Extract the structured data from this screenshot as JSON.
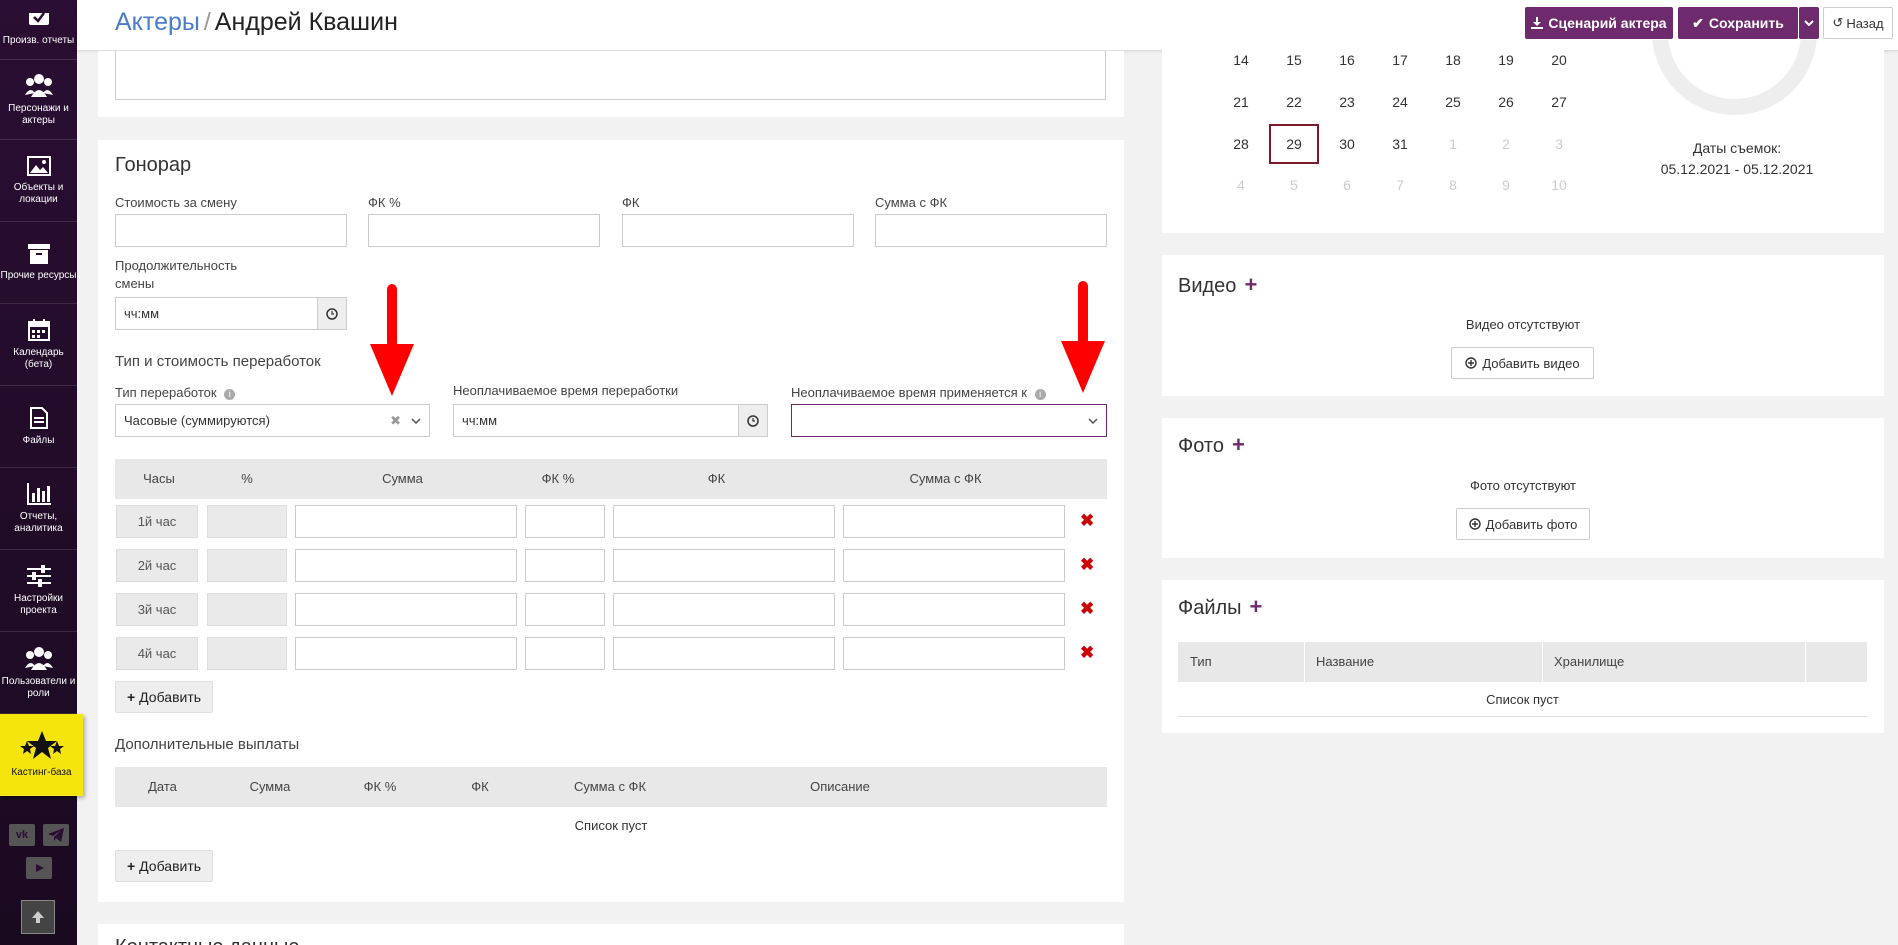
{
  "sidebar": {
    "items": [
      {
        "label": "Произв. отчеты",
        "icon": "check-icon"
      },
      {
        "label": "Персонажи и актеры",
        "icon": "users-icon"
      },
      {
        "label": "Объекты и локации",
        "icon": "image-icon"
      },
      {
        "label": "Прочие ресурсы",
        "icon": "box-icon"
      },
      {
        "label": "Календарь (бета)",
        "icon": "calendar-icon"
      },
      {
        "label": "Файлы",
        "icon": "file-icon"
      },
      {
        "label": "Отчеты, аналитика",
        "icon": "bar-chart-icon"
      },
      {
        "label": "Настройки проекта",
        "icon": "sliders-icon"
      },
      {
        "label": "Пользователи и роли",
        "icon": "users-icon"
      },
      {
        "label": "Кастинг-база",
        "icon": "stars-icon"
      }
    ],
    "social": [
      "vk",
      "telegram",
      "youtube"
    ]
  },
  "header": {
    "breadcrumb_link": "Актеры",
    "breadcrumb_sep": "/",
    "title": "Андрей Квашин",
    "script_button": "Сценарий актера",
    "save_button": "Сохранить",
    "back_button": "Назад"
  },
  "fee": {
    "title": "Гонорар",
    "labels": {
      "shift_cost": "Стоимость за смену",
      "fk_pct": "ФК %",
      "fk": "ФК",
      "sum_fk": "Сумма с ФК",
      "shift_duration": "Продолжительность смены"
    },
    "duration_placeholder": "чч:мм",
    "overtime_title": "Тип и стоимость переработок",
    "overtime_type_label": "Тип переработок",
    "overtime_type_value": "Часовые (суммируются)",
    "unpaid_time_label": "Неоплачиваемое время переработки",
    "unpaid_time_placeholder": "чч:мм",
    "unpaid_applies_label": "Неоплачиваемое время применяется к",
    "unpaid_applies_value": "",
    "table": {
      "headers": [
        "Часы",
        "%",
        "Сумма",
        "ФК %",
        "ФК",
        "Сумма с ФК"
      ],
      "rows": [
        "1й час",
        "2й час",
        "3й час",
        "4й час"
      ]
    },
    "add_button": "Добавить",
    "extra_title": "Дополнительные выплаты",
    "extra_headers": [
      "Дата",
      "Сумма",
      "ФК %",
      "ФК",
      "Сумма с ФК",
      "Описание"
    ],
    "extra_empty": "Список пуст",
    "extra_add_button": "Добавить",
    "next_section_partial": "Контактные данные"
  },
  "calendar": {
    "weeks": [
      [
        {
          "d": "14"
        },
        {
          "d": "15"
        },
        {
          "d": "16"
        },
        {
          "d": "17"
        },
        {
          "d": "18"
        },
        {
          "d": "19"
        },
        {
          "d": "20"
        }
      ],
      [
        {
          "d": "21"
        },
        {
          "d": "22"
        },
        {
          "d": "23"
        },
        {
          "d": "24"
        },
        {
          "d": "25"
        },
        {
          "d": "26"
        },
        {
          "d": "27"
        }
      ],
      [
        {
          "d": "28"
        },
        {
          "d": "29",
          "today": true
        },
        {
          "d": "30"
        },
        {
          "d": "31"
        },
        {
          "d": "1",
          "muted": true
        },
        {
          "d": "2",
          "muted": true
        },
        {
          "d": "3",
          "muted": true
        }
      ],
      [
        {
          "d": "4",
          "muted": true
        },
        {
          "d": "5",
          "muted": true
        },
        {
          "d": "6",
          "muted": true
        },
        {
          "d": "7",
          "muted": true
        },
        {
          "d": "8",
          "muted": true
        },
        {
          "d": "9",
          "muted": true
        },
        {
          "d": "10",
          "muted": true
        }
      ]
    ],
    "shoot_dates_label": "Даты съемок:",
    "shoot_dates_value": "05.12.2021 - 05.12.2021"
  },
  "video": {
    "title": "Видео",
    "empty": "Видео отсутствуют",
    "add_button": "Добавить видео"
  },
  "photo": {
    "title": "Фото",
    "empty": "Фото отсутствуют",
    "add_button": "Добавить фото"
  },
  "files": {
    "title": "Файлы",
    "headers": [
      "Тип",
      "Название",
      "Хранилище"
    ],
    "empty": "Список пуст"
  },
  "colors": {
    "accent": "#6d2a6d",
    "link": "#4a7cc9",
    "active_nav": "#f5e50c",
    "annotation_arrow": "#ff0000",
    "delete": "#cc0000"
  }
}
